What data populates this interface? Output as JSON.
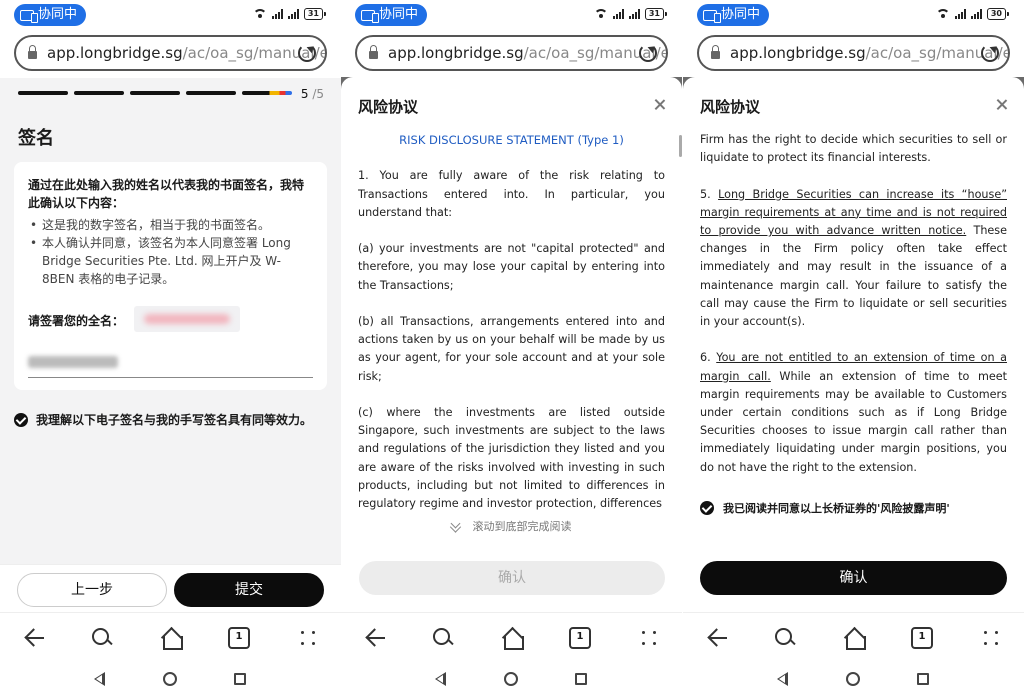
{
  "status": {
    "collab_label": "协同中",
    "battery": [
      "31",
      "31",
      "30"
    ]
  },
  "browser": {
    "url_host": "app.longbridge.sg",
    "url_path": "/ac/oa_sg/manual/e-",
    "tabs_count": "1"
  },
  "screen1": {
    "step_current": "5",
    "step_total": " /5",
    "title": "签名",
    "intro": "通过在此处输入我的姓名以代表我的书面签名，我特此确认以下内容：",
    "bullets": [
      "这是我的数字签名，相当于我的书面签名。",
      "本人确认并同意，该签名为本人同意签署 Long Bridge Securities Pte. Ltd. 网上开户及 W-8BEN 表格的电子记录。"
    ],
    "name_label": "请签署您的全名：",
    "agree_text": "我理解以下电子签名与我的手写签名具有同等效力。",
    "prev_button": "上一步",
    "submit_button": "提交"
  },
  "screen2": {
    "title": "风险协议",
    "statement_title": "RISK DISCLOSURE STATEMENT (Type 1)",
    "paragraphs": [
      "1.   You are fully aware of the risk relating to Transactions entered into. In particular, you understand that:",
      "(a)  your investments are not \"capital protected\" and therefore, you may lose your capital by entering into the Transactions;",
      "(b) all Transactions, arrangements entered into and actions taken by us on your behalf will be made by us as your agent, for your sole account and at your sole risk;",
      "(c) where the investments are listed outside Singapore, such investments are subject to the laws and regulations of the jurisdiction they listed and you are aware of the risks involved with investing in such products, including but not limited to differences in regulatory regime and investor protection, differences"
    ],
    "scroll_hint": "滚动到底部完成阅读",
    "confirm_button": "确认"
  },
  "screen3": {
    "title": "风险协议",
    "p_intro": "Firm has the right to decide which securities to sell or liquidate to protect its financial interests.",
    "p5_num": "5.   ",
    "p5_underlined": "Long Bridge Securities can increase its “house” margin requirements at any time and is not required to provide you with advance written notice.",
    "p5_rest": " These changes in the Firm policy often take effect immediately and may result in the issuance of a maintenance margin call. Your failure to satisfy the call may cause the Firm to liquidate or sell securities in your account(s).",
    "p6_num": "6.   ",
    "p6_underlined": "You are not entitled to an extension of time on a margin call.",
    "p6_rest": " While an extension of time to meet margin requirements may be available to Customers under certain conditions such as if Long Bridge Securities chooses to issue margin call rather than immediately liquidating under margin positions, you do not have the right to the extension.",
    "agree_text": "我已阅读并同意以上长桥证券的'风险披露声明'",
    "confirm_button": "确认"
  }
}
